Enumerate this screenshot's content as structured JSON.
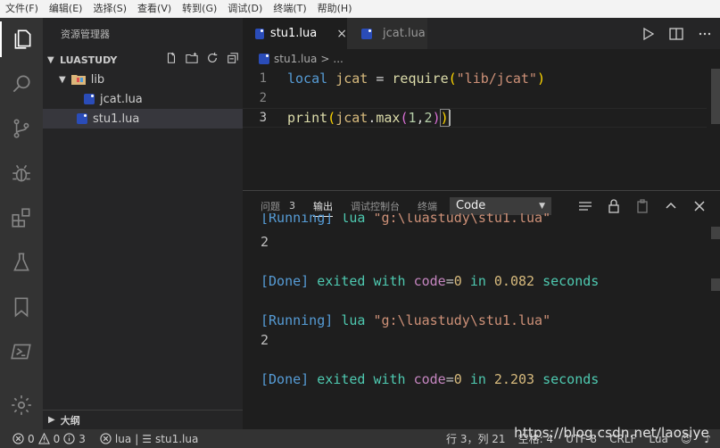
{
  "menu": [
    "文件(F)",
    "编辑(E)",
    "选择(S)",
    "查看(V)",
    "转到(G)",
    "调试(D)",
    "终端(T)",
    "帮助(H)"
  ],
  "activity": [
    "files-icon",
    "search-icon",
    "source-control-icon",
    "debug-icon",
    "extensions-icon",
    "flask-icon",
    "bookmark-icon",
    "powershell-icon"
  ],
  "sidebar": {
    "title": "资源管理器",
    "section": "LUASTUDY",
    "tree": {
      "lib": "lib",
      "jcat": "jcat.lua",
      "stu1": "stu1.lua"
    },
    "outline": "大纲"
  },
  "tabs": {
    "active": "stu1.lua",
    "inactive": "jcat.lua",
    "close": "×"
  },
  "breadcrumb": {
    "file": "stu1.lua",
    "sep": ">",
    "more": "..."
  },
  "code": {
    "ln1": "1",
    "ln2": "2",
    "ln3": "3",
    "l1_local": "local",
    "l1_var": "jcat",
    "l1_eq": "=",
    "l1_fn": "require",
    "l1_str": "\"lib/jcat\"",
    "l1_open": "(",
    "l1_close": ")",
    "l3_fn": "print",
    "l3_open": "(",
    "l3_var": "jcat",
    "l3_dot": ".",
    "l3_method": "max",
    "l3_open2": "(",
    "l3_n1": "1",
    "l3_comma": ",",
    "l3_n2": "2",
    "l3_close2": ")",
    "l3_close": ")"
  },
  "panel": {
    "problems": "问题",
    "problems_count": "3",
    "output": "输出",
    "debug_console": "调试控制台",
    "terminal": "终端",
    "select_value": "Code"
  },
  "output": {
    "running": "[Running]",
    "lua": "lua",
    "path": "\"g:\\luastudy\\stu1.lua\"",
    "result": "2",
    "done": "[Done]",
    "exited": "exited",
    "with": "with",
    "code_word": "code",
    "eq": "=",
    "zero": "0",
    "in": "in",
    "t1": "0.082",
    "t2": "2.203",
    "seconds": "seconds"
  },
  "status": {
    "errors": "0",
    "warnings": "0",
    "info": "3",
    "lang": "lua",
    "sep": "|",
    "file": "stu1.lua",
    "pos": "行 3，列 21",
    "spaces": "空格: 4",
    "encoding": "UTF-8",
    "eol": "CRLF",
    "mode": "Lua"
  },
  "watermark": "https://blog.csdn.net/laosiye"
}
